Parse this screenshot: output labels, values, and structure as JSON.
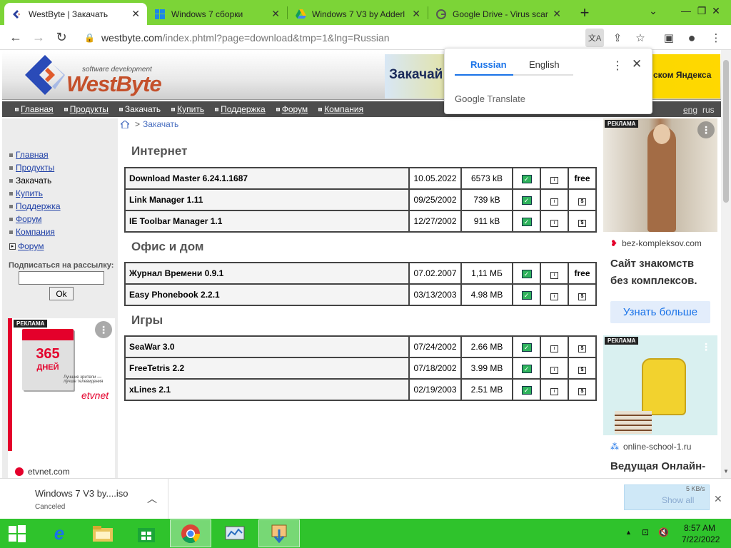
{
  "browser": {
    "tabs": [
      {
        "title": "WestByte | Закачать",
        "active": true,
        "icon": "westbyte-icon"
      },
      {
        "title": "Windows 7 сборки",
        "active": false,
        "icon": "windows-icon"
      },
      {
        "title": "Windows 7 V3 by Adderl",
        "active": false,
        "icon": "google-drive-icon"
      },
      {
        "title": "Google Drive - Virus scan",
        "active": false,
        "icon": "google-icon"
      }
    ],
    "url_host": "westbyte.com",
    "url_rest": "/index.phtml?page=download&tmp=1&lng=Russian"
  },
  "translate_popup": {
    "lang1": "Russian",
    "lang2": "English",
    "brand_google": "Google",
    "brand_translate": " Translate"
  },
  "site": {
    "logo_sub": "software development",
    "logo_text": "WestByte",
    "banner_left": "Закачай",
    "banner_right": "ском Яндекса",
    "nav": [
      "Главная",
      "Продукты",
      "Закачать",
      "Купить",
      "Поддержка",
      "Форум",
      "Компания"
    ],
    "lang_eng": "eng",
    "lang_rus": "rus",
    "sidebar_menu": [
      {
        "label": "Главная",
        "link": true
      },
      {
        "label": "Продукты",
        "link": true
      },
      {
        "label": "Закачать",
        "link": false
      },
      {
        "label": "Купить",
        "link": true
      },
      {
        "label": "Поддержка",
        "link": true
      },
      {
        "label": "Форум",
        "link": true
      },
      {
        "label": "Компания",
        "link": true
      }
    ],
    "forum_link": "Форум",
    "subscribe_label": "Подписаться на рассылку:",
    "subscribe_button": "Ok",
    "breadcrumb": "Закачать",
    "sections": [
      {
        "title": "Интернет",
        "rows": [
          {
            "name": "Download Master 6.24.1.1687",
            "date": "10.05.2022",
            "size": "6573 kB",
            "last": "free"
          },
          {
            "name": "Link Manager 1.11",
            "date": "09/25/2002",
            "size": "739 kB",
            "last": ""
          },
          {
            "name": "IE Toolbar Manager 1.1",
            "date": "12/27/2002",
            "size": "911 kB",
            "last": ""
          }
        ]
      },
      {
        "title": "Офис и дом",
        "rows": [
          {
            "name": "Журнал Времени 0.9.1",
            "date": "07.02.2007",
            "size": "1,11 МБ",
            "last": "free"
          },
          {
            "name": "Easy Phonebook 2.2.1",
            "date": "03/13/2003",
            "size": "4.98 MB",
            "last": ""
          }
        ]
      },
      {
        "title": "Игры",
        "rows": [
          {
            "name": "SeaWar 3.0",
            "date": "07/24/2002",
            "size": "2.66 MB",
            "last": ""
          },
          {
            "name": "FreeTetris 2.2",
            "date": "07/18/2002",
            "size": "3.99 MB",
            "last": ""
          },
          {
            "name": "xLines 2.1",
            "date": "02/19/2003",
            "size": "2.51 MB",
            "last": ""
          }
        ]
      }
    ]
  },
  "ads": {
    "tag": "РЕКЛАМА",
    "left_number": "365",
    "left_days": "ДНЕЙ",
    "left_small": "Лучшие зрители — лучше телевидения",
    "left_brand": "etvnet",
    "left_domain": "etvnet.com",
    "r1_domain": "bez-kompleksov.com",
    "r1_headline": "Сайт знакомств без комплексов.",
    "r1_button": "Узнать больше",
    "r2_domain": "online-school-1.ru",
    "r2_headline": "Ведущая Онлайн-"
  },
  "downloads": {
    "file": "Windows 7 V3 by....iso",
    "status": "Canceled",
    "speed": "5 KB/s",
    "show_all": "Show all"
  },
  "taskbar": {
    "time": "8:57 AM",
    "date": "7/22/2022"
  }
}
